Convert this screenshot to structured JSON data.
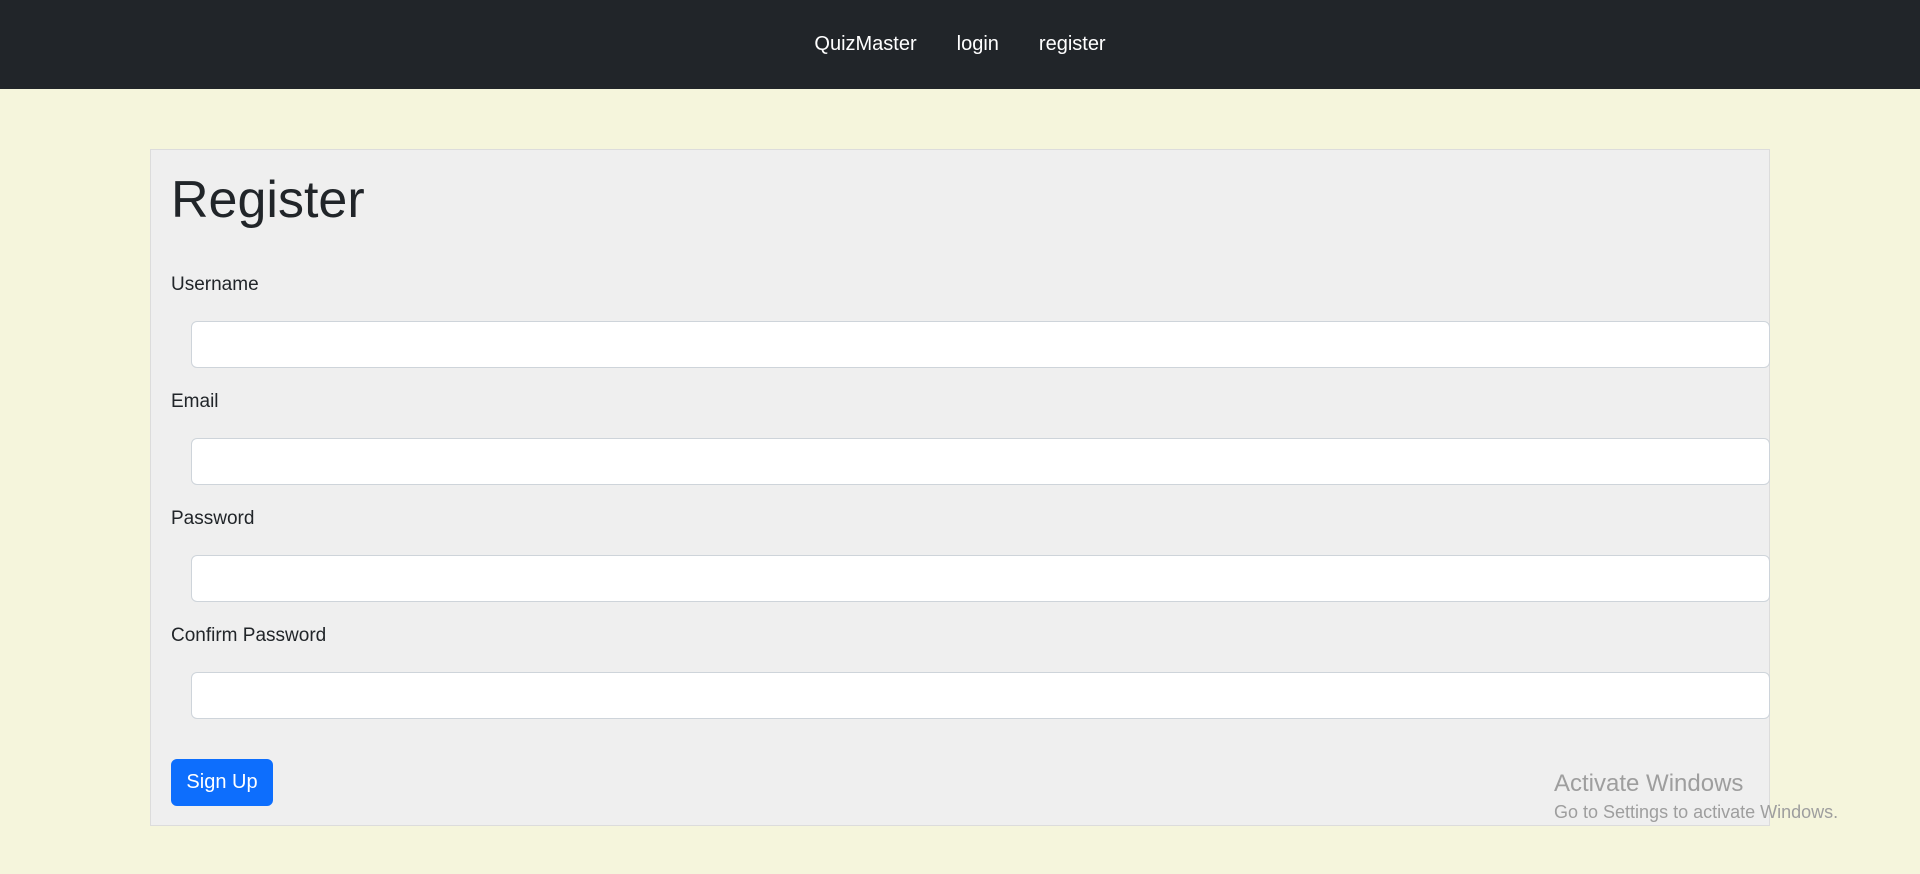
{
  "nav": {
    "brand": "QuizMaster",
    "links": [
      "login",
      "register"
    ]
  },
  "form": {
    "title": "Register",
    "fields": [
      {
        "label": "Username",
        "value": "",
        "type": "text"
      },
      {
        "label": "Email",
        "value": "",
        "type": "email"
      },
      {
        "label": "Password",
        "value": "",
        "type": "password"
      },
      {
        "label": "Confirm Password",
        "value": "",
        "type": "password"
      }
    ],
    "submit_label": "Sign Up"
  },
  "watermark": {
    "title": "Activate Windows",
    "subtitle": "Go to Settings to activate Windows."
  },
  "colors": {
    "page_bg": "#f5f5dc",
    "navbar_bg": "#212529",
    "card_bg": "#efefef",
    "accent": "#0d6efd"
  }
}
